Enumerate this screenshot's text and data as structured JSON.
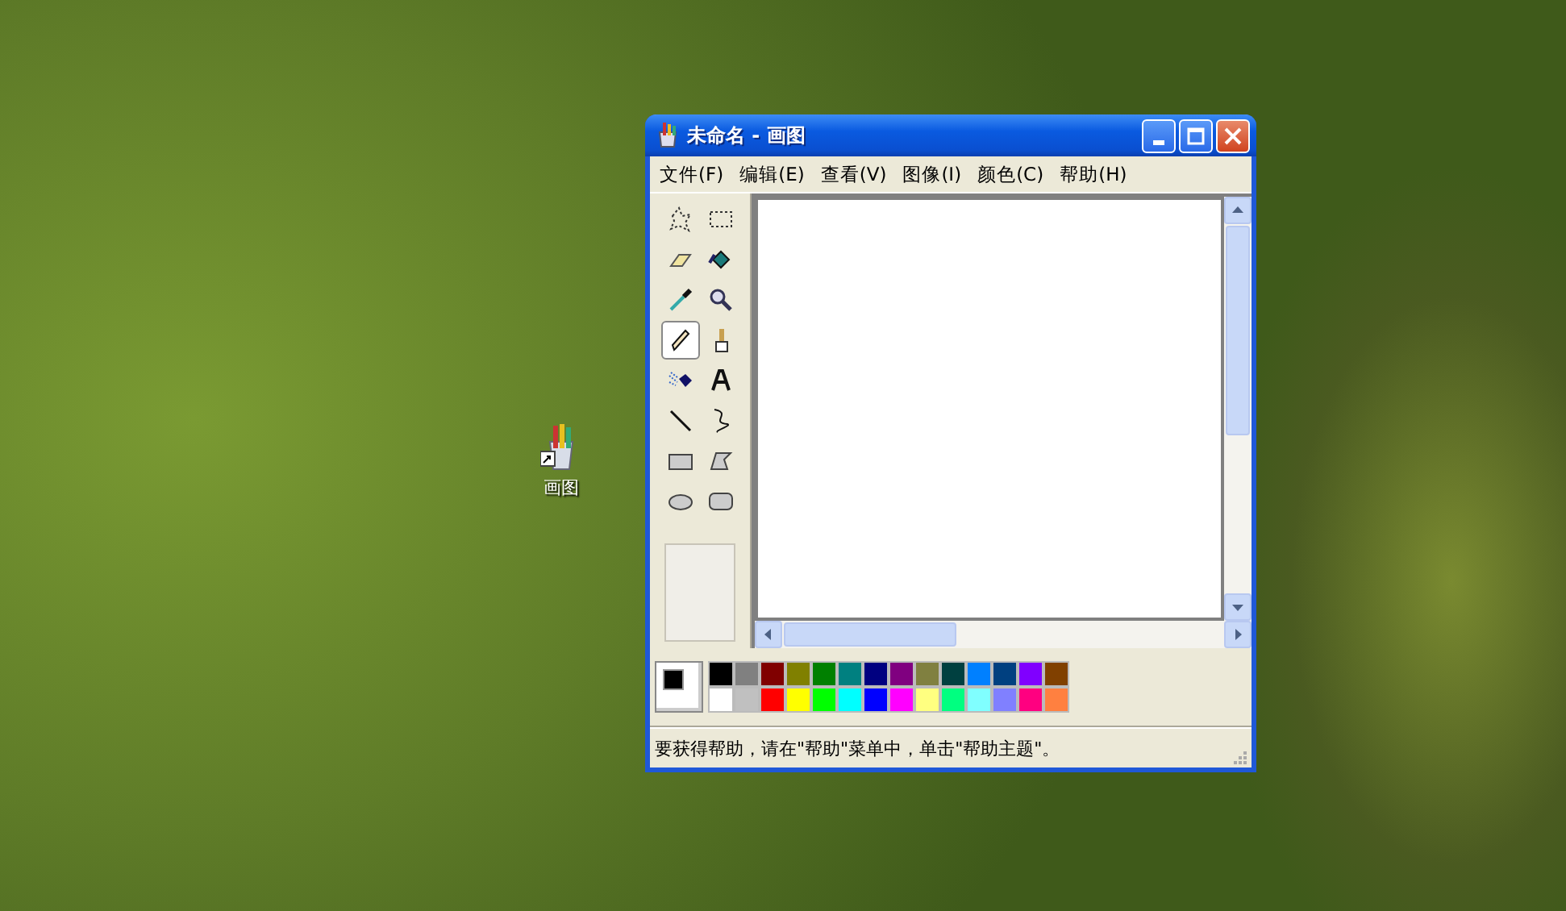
{
  "desktop_icons": [
    {
      "label": "画图"
    }
  ],
  "window": {
    "title": "未命名 - 画图"
  },
  "menu": [
    {
      "label": "文件(F)"
    },
    {
      "label": "编辑(E)"
    },
    {
      "label": "查看(V)"
    },
    {
      "label": "图像(I)"
    },
    {
      "label": "颜色(C)"
    },
    {
      "label": "帮助(H)"
    }
  ],
  "tools": [
    {
      "kind": "free-select",
      "selected": false
    },
    {
      "kind": "select",
      "selected": false
    },
    {
      "kind": "eraser",
      "selected": false
    },
    {
      "kind": "fill",
      "selected": false
    },
    {
      "kind": "picker",
      "selected": false
    },
    {
      "kind": "magnifier",
      "selected": false
    },
    {
      "kind": "pencil",
      "selected": true
    },
    {
      "kind": "brush",
      "selected": false
    },
    {
      "kind": "airbrush",
      "selected": false
    },
    {
      "kind": "text",
      "selected": false
    },
    {
      "kind": "line",
      "selected": false
    },
    {
      "kind": "curve",
      "selected": false
    },
    {
      "kind": "rectangle",
      "selected": false
    },
    {
      "kind": "polygon",
      "selected": false
    },
    {
      "kind": "ellipse",
      "selected": false
    },
    {
      "kind": "rounded-rectangle",
      "selected": false
    }
  ],
  "palette": [
    {
      "color": "#000000"
    },
    {
      "color": "#808080"
    },
    {
      "color": "#800000"
    },
    {
      "color": "#808000"
    },
    {
      "color": "#008000"
    },
    {
      "color": "#008080"
    },
    {
      "color": "#000080"
    },
    {
      "color": "#800080"
    },
    {
      "color": "#808040"
    },
    {
      "color": "#004040"
    },
    {
      "color": "#0080ff"
    },
    {
      "color": "#004080"
    },
    {
      "color": "#8000ff"
    },
    {
      "color": "#804000"
    },
    {
      "color": "#ffffff"
    },
    {
      "color": "#c0c0c0"
    },
    {
      "color": "#ff0000"
    },
    {
      "color": "#ffff00"
    },
    {
      "color": "#00ff00"
    },
    {
      "color": "#00ffff"
    },
    {
      "color": "#0000ff"
    },
    {
      "color": "#ff00ff"
    },
    {
      "color": "#ffff80"
    },
    {
      "color": "#00ff80"
    },
    {
      "color": "#80ffff"
    },
    {
      "color": "#8080ff"
    },
    {
      "color": "#ff0080"
    },
    {
      "color": "#ff8040"
    }
  ],
  "status_bar": {
    "text": "要获得帮助，请在\"帮助\"菜单中，单击\"帮助主题\"。"
  }
}
